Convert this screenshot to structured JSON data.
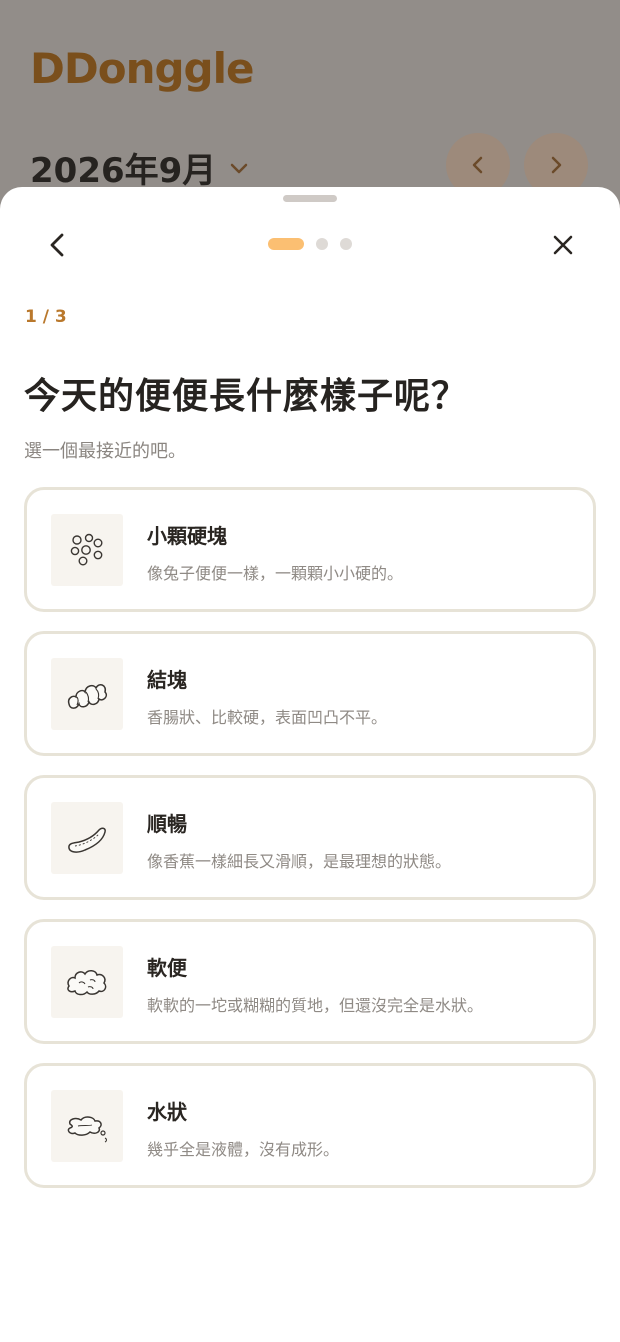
{
  "app": {
    "logo": "DDonggle",
    "month_title": "2026年9月",
    "icons": {
      "caret": "chevron-down-icon",
      "prev": "chevron-left-icon",
      "next": "chevron-right-icon"
    }
  },
  "sheet": {
    "step_label": "1 / 3",
    "question": "今天的便便長什麼樣子呢？",
    "hint": "選一個最接近的吧。",
    "pager": {
      "total": 3,
      "active": 1
    },
    "options": [
      {
        "title": "小顆硬塊",
        "desc": "像兔子便便一樣，一顆顆小小硬的。",
        "icon": "small-pellets-icon"
      },
      {
        "title": "結塊",
        "desc": "香腸狀、比較硬，表面凹凸不平。",
        "icon": "lumpy-sausage-icon"
      },
      {
        "title": "順暢",
        "desc": "像香蕉一樣細長又滑順，是最理想的狀態。",
        "icon": "smooth-banana-icon"
      },
      {
        "title": "軟便",
        "desc": "軟軟的一坨或糊糊的質地，但還沒完全是水狀。",
        "icon": "soft-blob-icon"
      },
      {
        "title": "水狀",
        "desc": "幾乎全是液體，沒有成形。",
        "icon": "watery-puddle-icon"
      }
    ]
  },
  "colors": {
    "accent": "#fbbf72",
    "step": "#b9782c",
    "logo": "#7a4f1c",
    "overlay": "#928d89",
    "card_border": "#e7e3d7"
  }
}
